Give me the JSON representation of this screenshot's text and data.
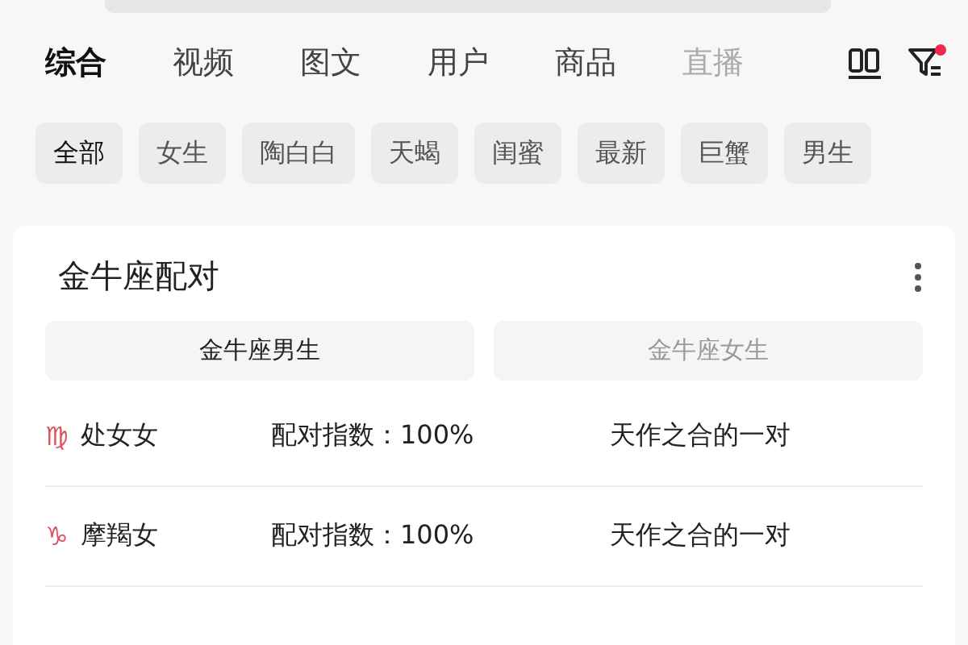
{
  "tabs": [
    {
      "label": "综合",
      "selected": true
    },
    {
      "label": "视频",
      "selected": false
    },
    {
      "label": "图文",
      "selected": false
    },
    {
      "label": "用户",
      "selected": false
    },
    {
      "label": "商品",
      "selected": false
    },
    {
      "label": "直播",
      "selected": false
    }
  ],
  "filter_has_notice": true,
  "chips": [
    {
      "label": "全部",
      "selected": true
    },
    {
      "label": "女生",
      "selected": false
    },
    {
      "label": "陶白白",
      "selected": false
    },
    {
      "label": "天蝎",
      "selected": false
    },
    {
      "label": "闺蜜",
      "selected": false
    },
    {
      "label": "最新",
      "selected": false
    },
    {
      "label": "巨蟹",
      "selected": false
    },
    {
      "label": "男生",
      "selected": false
    }
  ],
  "card": {
    "title": "金牛座配对",
    "toggles": [
      {
        "label": "金牛座男生",
        "selected": true
      },
      {
        "label": "金牛座女生",
        "selected": false
      }
    ],
    "rows": [
      {
        "symbol": "♍",
        "sign": "处女女",
        "score": "配对指数：100%",
        "verdict": "天作之合的一对"
      },
      {
        "symbol": "♑",
        "sign": "摩羯女",
        "score": "配对指数：100%",
        "verdict": "天作之合的一对"
      }
    ]
  }
}
